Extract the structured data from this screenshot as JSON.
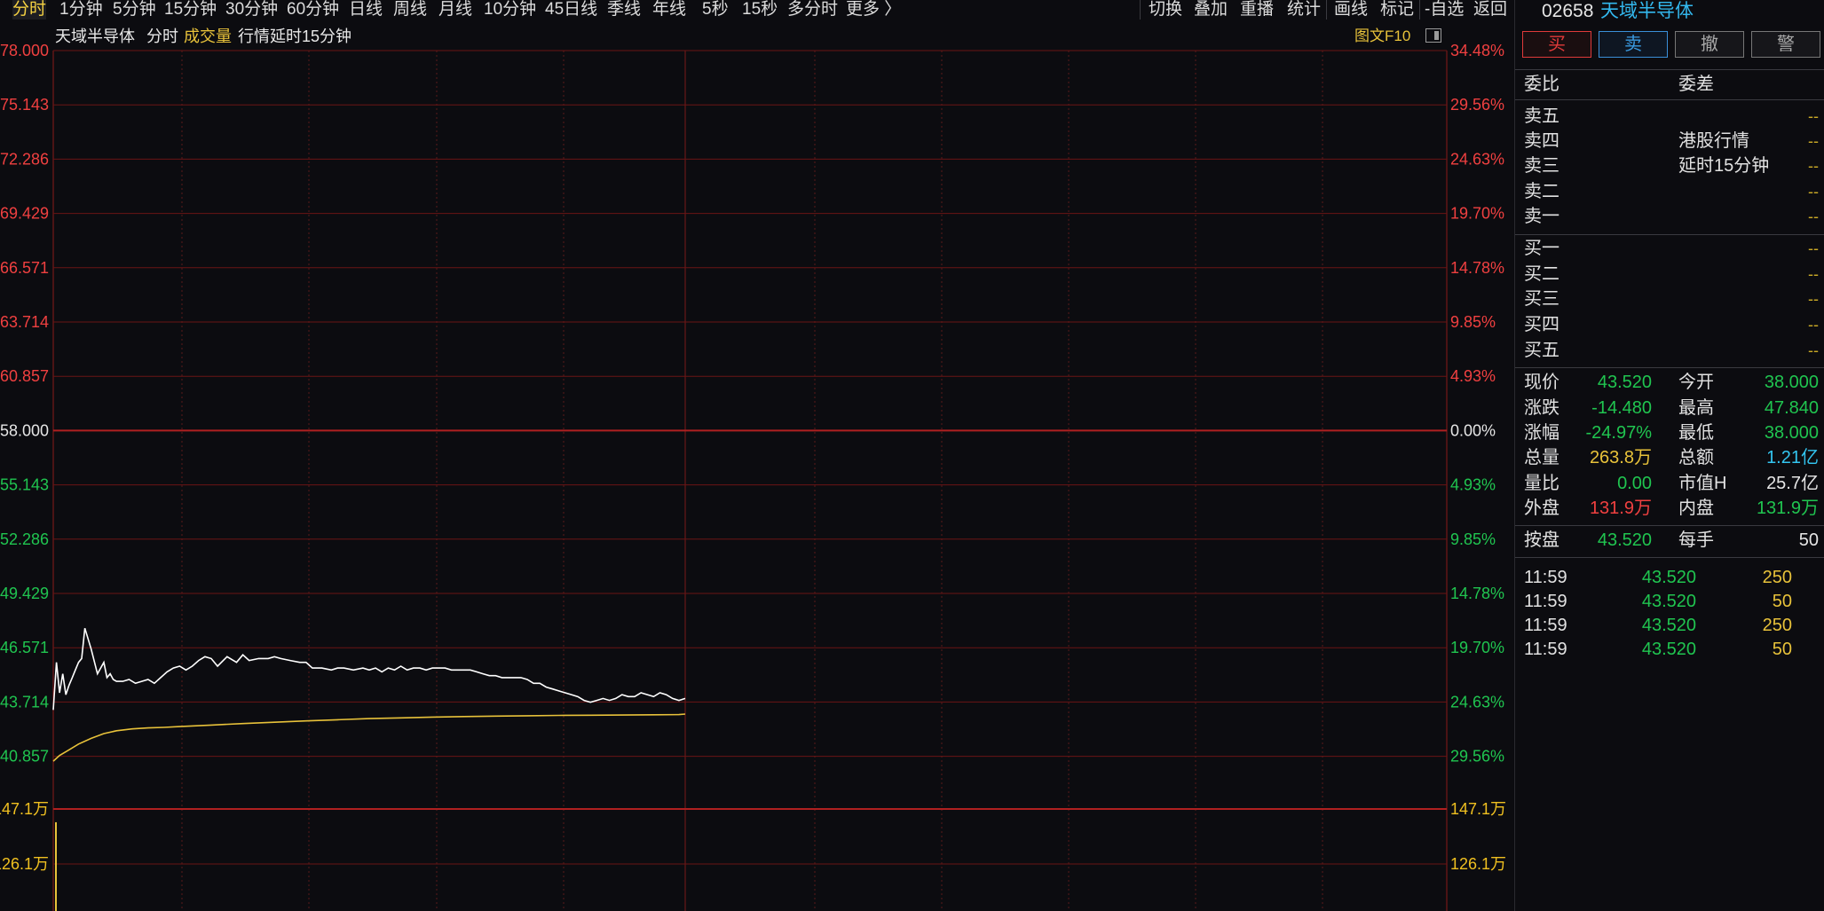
{
  "period_tabs": [
    "分时",
    "1分钟",
    "5分钟",
    "15分钟",
    "30分钟",
    "60分钟",
    "日线",
    "周线",
    "月线",
    "10分钟",
    "45日线",
    "季线",
    "年线",
    "5秒",
    "15秒",
    "多分时",
    "更多 〉"
  ],
  "active_period": "分时",
  "tool_tabs": [
    "切换",
    "叠加",
    "重播",
    "统计",
    "画线",
    "标记",
    "-自选",
    "返回"
  ],
  "chart_header": {
    "name": "天域半导体",
    "mode": "分时",
    "indicator": "成交量",
    "delay": "行情延时15分钟",
    "f10": "图文F10"
  },
  "chart_data": {
    "type": "line",
    "price_axis": {
      "left_labels": [
        "78.000",
        "75.143",
        "72.286",
        "69.429",
        "66.571",
        "63.714",
        "60.857",
        "58.000",
        "55.143",
        "52.286",
        "49.429",
        "46.571",
        "43.714",
        "40.857"
      ],
      "right_labels": [
        "34.48%",
        "29.56%",
        "24.63%",
        "19.70%",
        "14.78%",
        "9.85%",
        "4.93%",
        "0.00%",
        "4.93%",
        "9.85%",
        "14.78%",
        "19.70%",
        "24.63%",
        "29.56%"
      ],
      "prev_close": 58.0,
      "ylim": [
        40.857,
        78.0
      ]
    },
    "volume_axis": {
      "left_labels": [
        "147.1万",
        "126.1万"
      ],
      "right_labels": [
        "147.1万",
        "126.1万"
      ]
    },
    "series": [
      {
        "color": "#ffffff",
        "x": [
          0,
          1,
          2,
          3,
          4,
          5,
          6,
          7,
          8,
          9,
          10,
          12,
          14,
          16,
          17,
          18,
          19,
          20,
          22,
          24,
          26,
          28,
          30,
          32,
          34,
          36,
          38,
          40,
          42,
          44,
          46,
          48,
          50,
          52,
          55,
          58,
          60,
          62,
          65,
          68,
          70,
          72,
          75,
          78,
          80,
          82,
          85,
          88,
          90,
          92,
          95,
          98,
          100,
          102,
          104,
          106,
          108,
          110,
          112,
          114,
          116,
          118,
          120,
          122,
          124,
          126,
          128,
          130,
          132,
          134,
          136,
          138,
          140,
          142,
          144,
          146,
          148,
          150,
          152,
          154,
          156,
          158,
          160,
          162,
          164,
          166,
          168,
          170,
          172,
          174,
          176,
          178,
          180,
          182,
          184,
          186,
          188,
          190,
          192,
          194,
          196,
          198,
          200
        ],
        "values": [
          43.3,
          45.8,
          44.2,
          45.2,
          44.1,
          44.6,
          45.0,
          45.4,
          45.8,
          46.0,
          47.6,
          46.5,
          45.2,
          45.8,
          45.0,
          45.2,
          44.9,
          44.8,
          44.8,
          44.9,
          44.7,
          44.8,
          44.9,
          44.7,
          45.0,
          45.3,
          45.5,
          45.6,
          45.4,
          45.6,
          45.9,
          46.1,
          46.0,
          45.6,
          46.1,
          45.8,
          46.2,
          45.9,
          46.0,
          46.0,
          46.1,
          46.0,
          45.9,
          45.8,
          45.8,
          45.5,
          45.5,
          45.4,
          45.5,
          45.5,
          45.4,
          45.5,
          45.4,
          45.5,
          45.3,
          45.5,
          45.4,
          45.6,
          45.4,
          45.5,
          45.5,
          45.4,
          45.5,
          45.5,
          45.5,
          45.4,
          45.4,
          45.4,
          45.4,
          45.3,
          45.2,
          45.1,
          45.1,
          45.0,
          45.0,
          45.0,
          45.0,
          44.9,
          44.7,
          44.7,
          44.5,
          44.4,
          44.3,
          44.2,
          44.1,
          44.0,
          43.8,
          43.7,
          43.8,
          43.9,
          43.8,
          43.9,
          44.1,
          44.0,
          44.0,
          44.2,
          44.1,
          44.0,
          44.2,
          44.1,
          43.9,
          43.8,
          43.9
        ]
      },
      {
        "color": "#e8c23a",
        "x": [
          0,
          2,
          5,
          8,
          12,
          16,
          20,
          25,
          30,
          35,
          40,
          50,
          60,
          70,
          80,
          90,
          100,
          110,
          120,
          130,
          140,
          150,
          160,
          170,
          180,
          190,
          198,
          200
        ],
        "values": [
          40.6,
          40.9,
          41.2,
          41.5,
          41.8,
          42.05,
          42.2,
          42.3,
          42.35,
          42.38,
          42.42,
          42.5,
          42.58,
          42.65,
          42.72,
          42.78,
          42.84,
          42.88,
          42.92,
          42.95,
          42.97,
          42.99,
          43.01,
          43.02,
          43.03,
          43.04,
          43.05,
          43.08
        ]
      }
    ],
    "volume_bars": [
      {
        "x": 0,
        "value": 128
      }
    ],
    "grid": true
  },
  "right_panel": {
    "code": "02658",
    "name": "天域半导体",
    "buttons": {
      "buy": "买",
      "sell": "卖",
      "cancel": "撤",
      "alert": "警"
    },
    "weibi_label": "委比",
    "weicha_label": "委差",
    "asks": [
      {
        "label": "卖五",
        "note": "",
        "value": "--"
      },
      {
        "label": "卖四",
        "note": "港股行情",
        "value": "--"
      },
      {
        "label": "卖三",
        "note": "延时15分钟",
        "value": "--"
      },
      {
        "label": "卖二",
        "note": "",
        "value": "--"
      },
      {
        "label": "卖一",
        "note": "",
        "value": "--"
      }
    ],
    "bids": [
      {
        "label": "买一",
        "value": "--"
      },
      {
        "label": "买二",
        "value": "--"
      },
      {
        "label": "买三",
        "value": "--"
      },
      {
        "label": "买四",
        "value": "--"
      },
      {
        "label": "买五",
        "value": "--"
      }
    ],
    "quote": [
      {
        "l1": "现价",
        "v1": "43.520",
        "c1": "green",
        "l2": "今开",
        "v2": "38.000",
        "c2": "green"
      },
      {
        "l1": "涨跌",
        "v1": "-14.480",
        "c1": "green",
        "l2": "最高",
        "v2": "47.840",
        "c2": "green"
      },
      {
        "l1": "涨幅",
        "v1": "-24.97%",
        "c1": "green",
        "l2": "最低",
        "v2": "38.000",
        "c2": "green"
      },
      {
        "l1": "总量",
        "v1": "263.8万",
        "c1": "yellow",
        "l2": "总额",
        "v2": "1.21亿",
        "c2": "cyan"
      },
      {
        "l1": "量比",
        "v1": "0.00",
        "c1": "green",
        "l2": "市值H",
        "v2": "25.7亿",
        "c2": "white"
      },
      {
        "l1": "外盘",
        "v1": "131.9万",
        "c1": "red",
        "l2": "内盘",
        "v2": "131.9万",
        "c2": "green"
      }
    ],
    "anpan": {
      "l1": "按盘",
      "v1": "43.520",
      "l2": "每手",
      "v2": "50"
    },
    "ticks": [
      {
        "time": "11:59",
        "price": "43.520",
        "vol": "250"
      },
      {
        "time": "11:59",
        "price": "43.520",
        "vol": "50"
      },
      {
        "time": "11:59",
        "price": "43.520",
        "vol": "250"
      },
      {
        "time": "11:59",
        "price": "43.520",
        "vol": "50"
      }
    ]
  }
}
